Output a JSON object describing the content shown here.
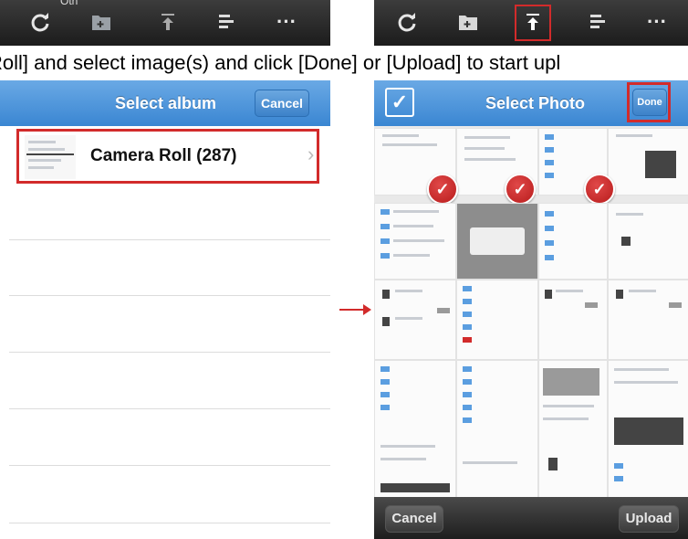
{
  "caption": "Roll] and select image(s) and click [Done] or [Upload] to start upl",
  "top_label_partial": "Oth",
  "left_toolbar": {
    "icons": [
      "refresh-icon",
      "folder-add-icon",
      "upload-icon",
      "sort-icon",
      "more-icon"
    ],
    "more_text": "···"
  },
  "right_toolbar": {
    "icons": [
      "refresh-icon",
      "folder-add-icon",
      "upload-icon",
      "sort-icon",
      "more-icon"
    ],
    "more_text": "···",
    "highlighted": "upload-icon"
  },
  "left_screen": {
    "title": "Select album",
    "cancel_label": "Cancel",
    "album": {
      "name": "Camera Roll (287)",
      "chevron": "›"
    }
  },
  "right_screen": {
    "title": "Select Photo",
    "done_label": "Done",
    "checkbox_mark": "✓",
    "check_mark": "✓",
    "cancel_label": "Cancel",
    "upload_label": "Upload",
    "arrow": "→"
  },
  "colors": {
    "nav_blue": "#4a94dd",
    "highlight_red": "#d22b2b",
    "toolbar_dark": "#2a2a2a"
  }
}
